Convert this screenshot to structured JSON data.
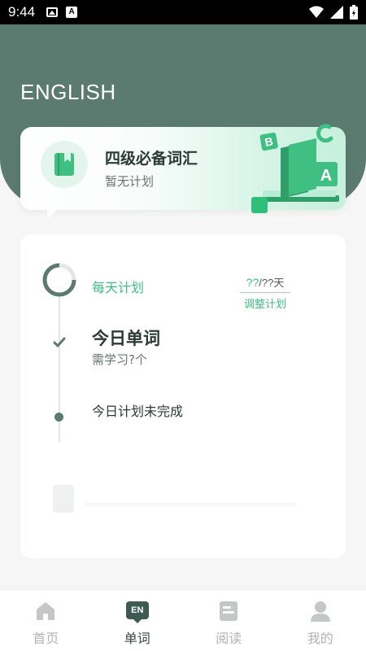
{
  "status_bar": {
    "time": "9:44"
  },
  "header": {
    "title": "ENGLISH"
  },
  "book": {
    "title": "四级必备词汇",
    "subtitle": "暂无计划"
  },
  "plan": {
    "daily_label": "每天计划",
    "adjust_value_main": "??",
    "adjust_value_rest": "/??天",
    "adjust_button": "调整计划",
    "today_title": "今日单词",
    "today_sub": "需学习?个",
    "incomplete": "今日计划未完成"
  },
  "tabs": [
    {
      "label": "首页",
      "icon": "home-icon",
      "active": false
    },
    {
      "label": "单词",
      "icon": "en-badge-icon",
      "active": true,
      "badge": "EN"
    },
    {
      "label": "阅读",
      "icon": "document-icon",
      "active": false
    },
    {
      "label": "我的",
      "icon": "user-icon",
      "active": false
    }
  ],
  "colors": {
    "primary": "#5b7b70",
    "accent": "#3fbf82",
    "inactive": "#b0b4b2"
  }
}
